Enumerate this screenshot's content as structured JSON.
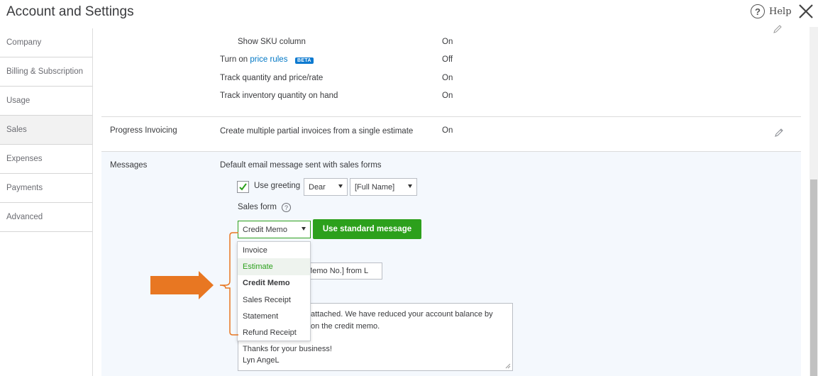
{
  "header": {
    "title": "Account and Settings",
    "help_label": "Help"
  },
  "sidebar": {
    "items": [
      {
        "label": "Company"
      },
      {
        "label": "Billing & Subscription"
      },
      {
        "label": "Usage"
      },
      {
        "label": "Sales",
        "active": true
      },
      {
        "label": "Expenses"
      },
      {
        "label": "Payments"
      },
      {
        "label": "Advanced"
      }
    ]
  },
  "products": {
    "sku_label": "Show SKU column",
    "sku_value": "On",
    "price_rules_prefix": "Turn on ",
    "price_rules_link": "price rules",
    "beta": "BETA",
    "price_rules_value": "Off",
    "track_qty_label": "Track quantity and price/rate",
    "track_qty_value": "On",
    "track_inv_label": "Track inventory quantity on hand",
    "track_inv_value": "On"
  },
  "progress": {
    "label": "Progress Invoicing",
    "desc": "Create multiple partial invoices from a single estimate",
    "value": "On"
  },
  "messages": {
    "label": "Messages",
    "desc": "Default email message sent with sales forms",
    "use_greeting": "Use greeting",
    "greeting_option": "Dear",
    "name_option": "[Full Name]",
    "sales_form_label": "Sales form",
    "sales_form_value": "Credit Memo",
    "use_standard_btn": "Use standard message",
    "subject_value": "t Memo No.] from L",
    "body_line1": "attached.  We have reduced your account balance by",
    "body_line2": "on the credit memo.",
    "body_line3": "Thanks for your business!",
    "body_line4": "Lyn AngeL"
  },
  "dropdown": {
    "options": [
      {
        "label": "Invoice"
      },
      {
        "label": "Estimate",
        "highlighted": true
      },
      {
        "label": "Credit Memo",
        "selected": true
      },
      {
        "label": "Sales Receipt"
      },
      {
        "label": "Statement"
      },
      {
        "label": "Refund Receipt"
      }
    ]
  },
  "colors": {
    "accent_green": "#2ca01c",
    "link_blue": "#0077c5",
    "arrow_orange": "#e87722"
  }
}
